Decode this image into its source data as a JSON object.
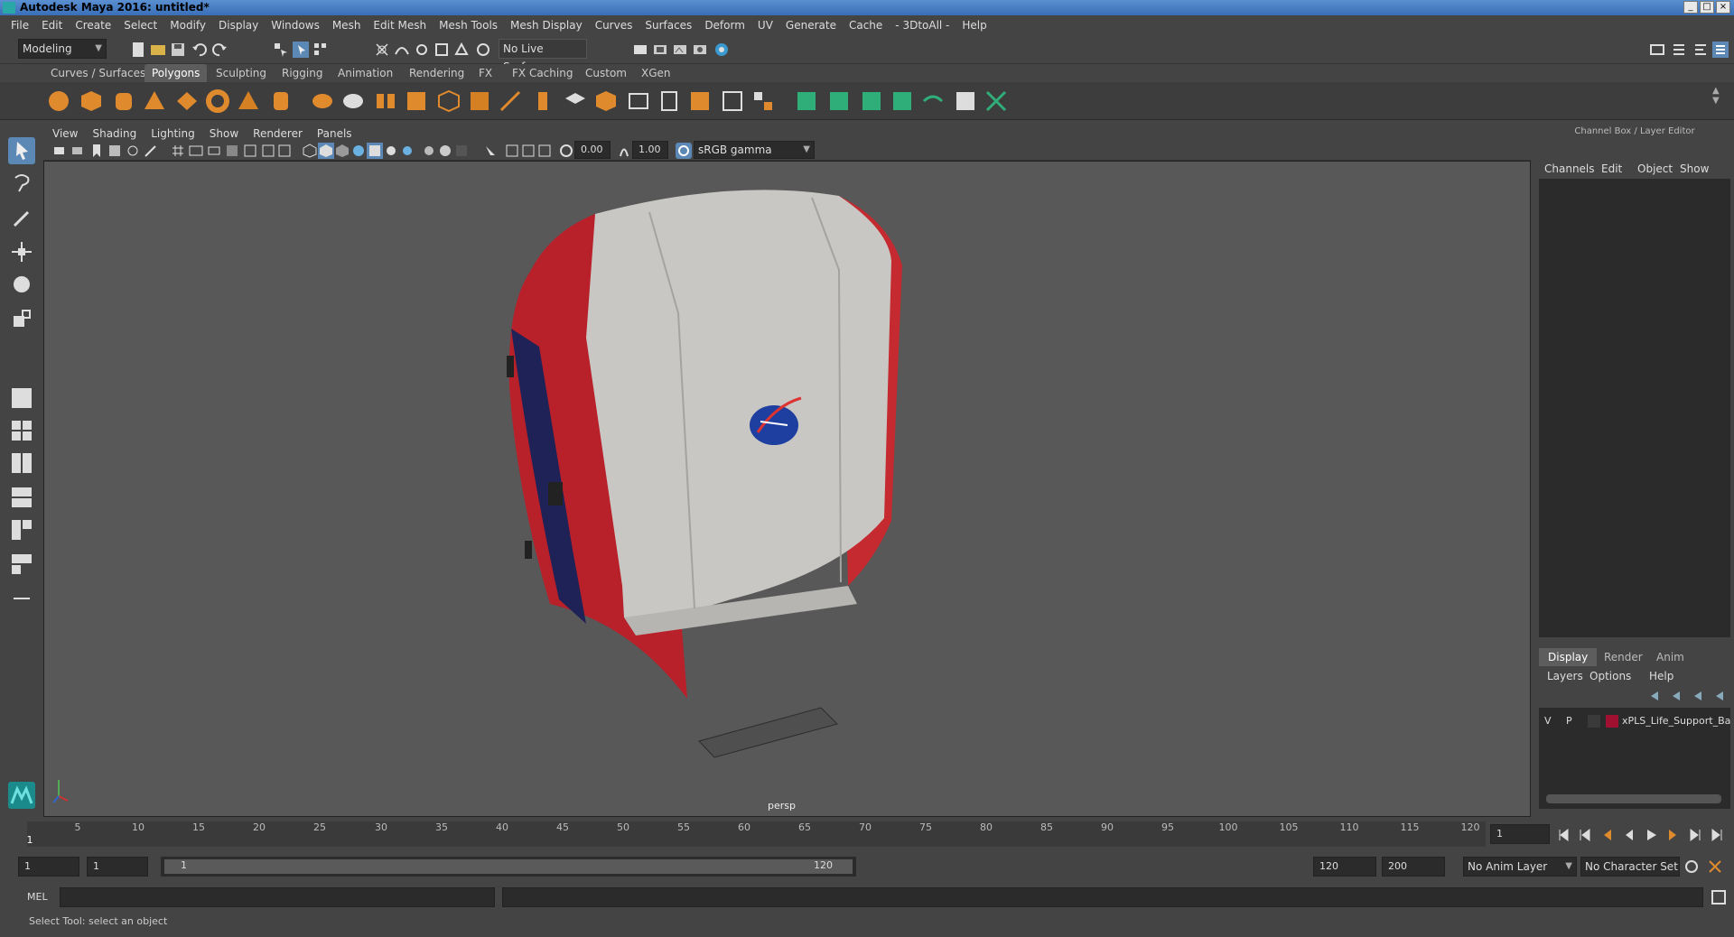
{
  "window": {
    "title": "Autodesk Maya 2016: untitled*"
  },
  "menus": [
    "File",
    "Edit",
    "Create",
    "Select",
    "Modify",
    "Display",
    "Windows",
    "Mesh",
    "Edit Mesh",
    "Mesh Tools",
    "Mesh Display",
    "Curves",
    "Surfaces",
    "Deform",
    "UV",
    "Generate",
    "Cache",
    "- 3DtoAll -",
    "Help"
  ],
  "status_line": {
    "mode": "Modeling",
    "live_surface": "No Live Surface"
  },
  "shelf_tabs": [
    "Curves / Surfaces",
    "Polygons",
    "Sculpting",
    "Rigging",
    "Animation",
    "Rendering",
    "FX",
    "FX Caching",
    "Custom",
    "XGen"
  ],
  "viewport": {
    "menus": [
      "View",
      "Shading",
      "Lighting",
      "Show",
      "Renderer",
      "Panels"
    ],
    "exposure": "0.00",
    "gamma": "1.00",
    "color_space": "sRGB gamma",
    "camera_label": "persp"
  },
  "channel_box": {
    "title": "Channel Box / Layer Editor",
    "menus": [
      "Channels",
      "Edit",
      "Object",
      "Show"
    ],
    "layer_tabs": [
      "Display",
      "Render",
      "Anim"
    ],
    "layer_menus": [
      "Layers",
      "Options",
      "Help"
    ],
    "layer": {
      "v": "V",
      "p": "P",
      "name": "xPLS_Life_Support_Bac"
    }
  },
  "time_slider": {
    "ticks": [
      "1",
      "5",
      "10",
      "15",
      "20",
      "25",
      "30",
      "35",
      "40",
      "45",
      "50",
      "55",
      "60",
      "65",
      "70",
      "75",
      "80",
      "85",
      "90",
      "95",
      "100",
      "105",
      "110",
      "115",
      "120"
    ],
    "current_frame": "1"
  },
  "range_slider": {
    "start": "1",
    "playback_start": "1",
    "range_label_left": "1",
    "range_label_right": "120",
    "playback_end": "120",
    "end": "200",
    "anim_layer": "No Anim Layer",
    "character_set": "No Character Set"
  },
  "command_line": {
    "label": "MEL"
  },
  "help_line": {
    "text": "Select Tool: select an object"
  }
}
